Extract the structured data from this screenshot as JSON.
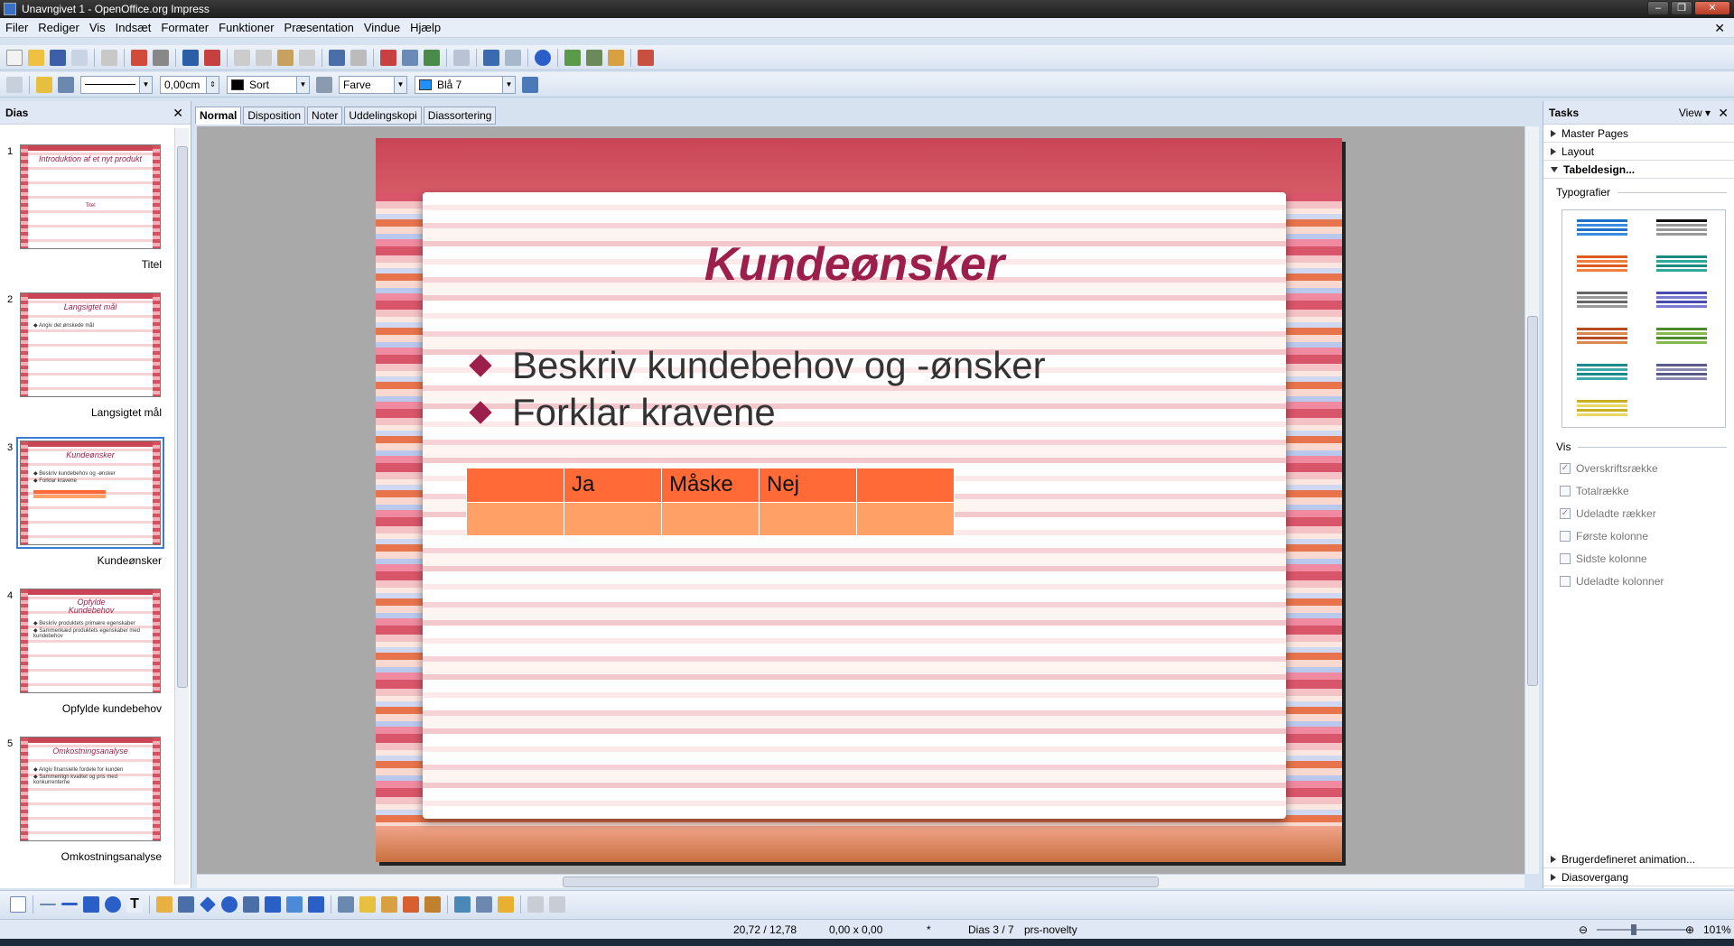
{
  "window": {
    "title": "Unavngivet 1 - OpenOffice.org Impress"
  },
  "menu": [
    "Filer",
    "Rediger",
    "Vis",
    "Indsæt",
    "Formater",
    "Funktioner",
    "Præsentation",
    "Vindue",
    "Hjælp"
  ],
  "format_bar": {
    "line_width": "0,00cm",
    "line_color": "Sort",
    "area_style": "Farve",
    "area_color": "Blå 7",
    "line_color_hex": "#000000",
    "area_color_hex": "#1e90ff"
  },
  "slides_panel": {
    "title": "Dias",
    "slides": [
      {
        "num": "1",
        "name": "Titel",
        "thumb_title": "Introduktion af et nyt produkt",
        "thumb_lines": [
          "Titel"
        ]
      },
      {
        "num": "2",
        "name": "Langsigtet mål",
        "thumb_title": "Langsigtet mål",
        "thumb_lines": [
          "◆ Angiv det ønskede mål"
        ]
      },
      {
        "num": "3",
        "name": "Kundeønsker",
        "thumb_title": "Kundeønsker",
        "thumb_lines": [
          "◆ Beskriv kundebehov og -ønsker",
          "◆ Forklar kravene"
        ]
      },
      {
        "num": "4",
        "name": "Opfylde kundebehov",
        "thumb_title": "Opfylde Kundebehov",
        "thumb_lines": [
          "◆ Beskriv produktets primære egenskaber",
          "◆ Sammenkæd produktets egenskaber med kundebehov"
        ]
      },
      {
        "num": "5",
        "name": "Omkostningsanalyse",
        "thumb_title": "Omkostningsanalyse",
        "thumb_lines": [
          "◆ Angiv finansielle fordele for kunden",
          "◆ Sammenlign kvalitet og pris med konkurrenterne"
        ]
      }
    ]
  },
  "view_tabs": [
    "Normal",
    "Disposition",
    "Noter",
    "Uddelingskopi",
    "Diassortering"
  ],
  "slide": {
    "title": "Kundeønsker",
    "bullets": [
      "Beskriv kundebehov og -ønsker",
      "Forklar kravene"
    ],
    "table": {
      "header": [
        "",
        "Ja",
        "Måske",
        "Nej",
        ""
      ],
      "row": [
        "",
        "",
        "",
        "",
        ""
      ]
    },
    "title_color": "#9b1f4a",
    "table_header_color": "#ff6a36",
    "table_body_color": "#ffa066"
  },
  "tasks_panel": {
    "title": "Tasks",
    "view_label": "View",
    "sections": [
      "Master Pages",
      "Layout",
      "Tabeldesign..."
    ],
    "typografier_label": "Typografier",
    "vis_label": "Vis",
    "options": [
      {
        "label": "Overskriftsrække",
        "checked": true
      },
      {
        "label": "Totalrække",
        "checked": false
      },
      {
        "label": "Udeladte rækker",
        "checked": true
      },
      {
        "label": "Første kolonne",
        "checked": false
      },
      {
        "label": "Sidste kolonne",
        "checked": false
      },
      {
        "label": "Udeladte kolonner",
        "checked": false
      }
    ],
    "bottom_sections": [
      "Brugerdefineret animation...",
      "Diasovergang"
    ]
  },
  "status": {
    "position": "20,72 / 12,78",
    "size": "0,00 x 0,00",
    "modified": "*",
    "slide": "Dias 3 / 7",
    "master": "prs-novelty",
    "zoom": "101%"
  }
}
